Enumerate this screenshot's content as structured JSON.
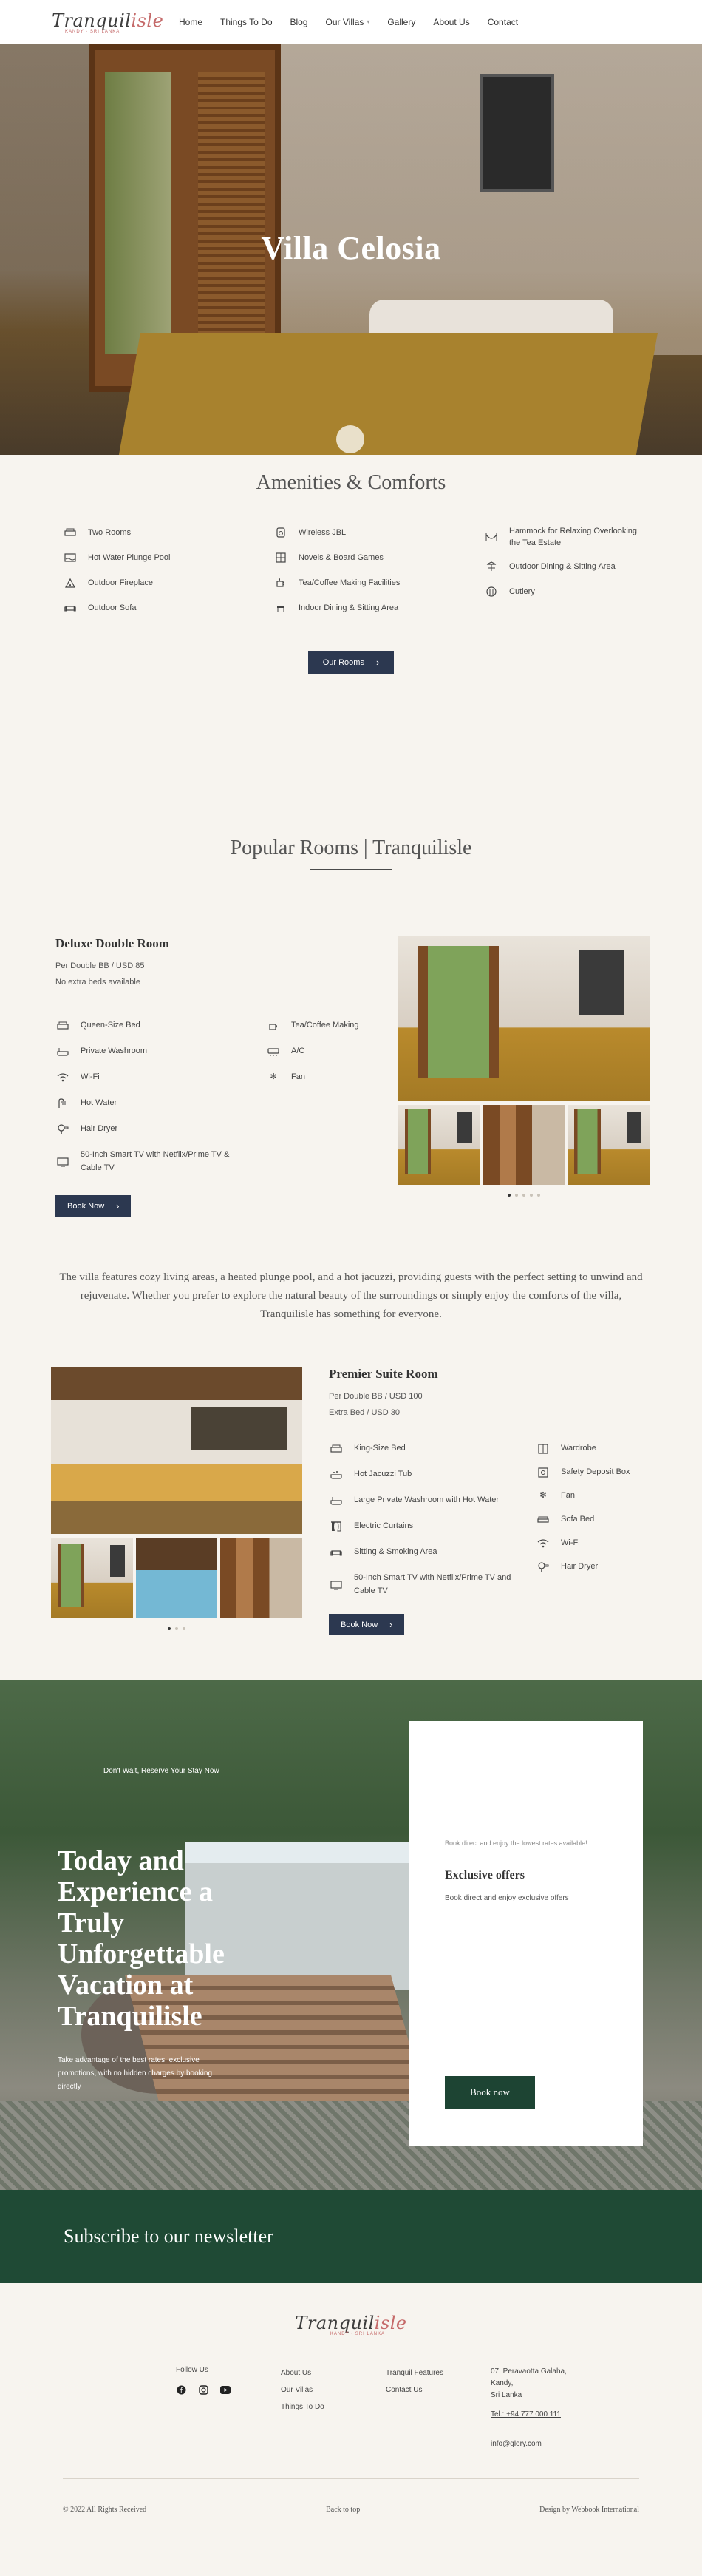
{
  "header": {
    "logo_main": "Tranquil",
    "logo_accent": "isle",
    "logo_sub": "KANDY · SRI LANKA",
    "nav": [
      {
        "label": "Home"
      },
      {
        "label": "Things To Do"
      },
      {
        "label": "Blog"
      },
      {
        "label": "Our Villas",
        "dropdown": true
      },
      {
        "label": "Gallery"
      },
      {
        "label": "About Us"
      },
      {
        "label": "Contact"
      }
    ]
  },
  "hero": {
    "title": "Villa Celosia"
  },
  "amenities": {
    "title": "Amenities & Comforts",
    "columns": [
      [
        {
          "icon": "bed-icon",
          "label": "Two Rooms"
        },
        {
          "icon": "pool-icon",
          "label": "Hot Water Plunge Pool"
        },
        {
          "icon": "fireplace-icon",
          "label": "Outdoor Fireplace"
        },
        {
          "icon": "sofa-icon",
          "label": "Outdoor Sofa"
        }
      ],
      [
        {
          "icon": "speaker-icon",
          "label": "Wireless JBL"
        },
        {
          "icon": "board-games-icon",
          "label": "Novels & Board Games"
        },
        {
          "icon": "kettle-icon",
          "label": "Tea/Coffee Making Facilities"
        },
        {
          "icon": "dining-icon",
          "label": "Indoor Dining & Sitting Area"
        }
      ],
      [
        {
          "icon": "hammock-icon",
          "label": "Hammock for Relaxing Overlooking the Tea Estate"
        },
        {
          "icon": "outdoor-dining-icon",
          "label": "Outdoor Dining & Sitting Area"
        },
        {
          "icon": "cutlery-icon",
          "label": "Cutlery"
        }
      ]
    ],
    "button": "Our Rooms"
  },
  "rooms": {
    "title": "Popular Rooms | Tranquilisle",
    "deluxe": {
      "name": "Deluxe Double Room",
      "price": "Per Double BB / USD 85",
      "extra": "No extra beds available",
      "features_left": [
        {
          "icon": "bed-icon",
          "label": "Queen-Size Bed"
        },
        {
          "icon": "bath-icon",
          "label": "Private Washroom"
        },
        {
          "icon": "wifi-icon",
          "label": "Wi-Fi"
        },
        {
          "icon": "shower-icon",
          "label": "Hot Water"
        },
        {
          "icon": "hair-dryer-icon",
          "label": "Hair Dryer"
        },
        {
          "icon": "tv-icon",
          "label": "50-Inch Smart TV with Netflix/Prime TV & Cable TV"
        }
      ],
      "features_right": [
        {
          "icon": "kettle-icon",
          "label": "Tea/Coffee Making"
        },
        {
          "icon": "ac-icon",
          "label": "A/C"
        },
        {
          "icon": "fan-icon",
          "label": "Fan"
        }
      ],
      "button": "Book Now"
    },
    "description": "The villa features cozy living areas, a heated plunge pool, and a hot jacuzzi, providing guests with the perfect setting to unwind and rejuvenate. Whether you prefer to explore the natural beauty of the surroundings or simply enjoy the comforts of the villa, Tranquilisle has something for everyone.",
    "premier": {
      "name": "Premier Suite Room",
      "price": "Per Double BB / USD 100",
      "extra": "Extra Bed / USD 30",
      "features_left": [
        {
          "icon": "bed-icon",
          "label": "King-Size Bed"
        },
        {
          "icon": "jacuzzi-icon",
          "label": "Hot Jacuzzi Tub"
        },
        {
          "icon": "bath-icon",
          "label": "Large Private Washroom with Hot Water"
        },
        {
          "icon": "curtain-icon",
          "label": "Electric Curtains"
        },
        {
          "icon": "sofa-icon",
          "label": "Sitting & Smoking Area"
        },
        {
          "icon": "tv-icon",
          "label": "50-Inch Smart TV with Netflix/Prime TV and Cable TV"
        }
      ],
      "features_right": [
        {
          "icon": "wardrobe-icon",
          "label": "Wardrobe"
        },
        {
          "icon": "safe-icon",
          "label": "Safety Deposit Box"
        },
        {
          "icon": "fan-icon",
          "label": "Fan"
        },
        {
          "icon": "sofa-bed-icon",
          "label": "Sofa Bed"
        },
        {
          "icon": "wifi-icon",
          "label": "Wi-Fi"
        },
        {
          "icon": "hair-dryer-icon",
          "label": "Hair Dryer"
        }
      ],
      "button": "Book Now"
    }
  },
  "cta": {
    "kicker": "Don't Wait, Reserve Your Stay Now",
    "title": "Today and Experience a Truly Unforgettable Vacation at Tranquilisle",
    "text": "Take advantage of the best rates, exclusive promotions, with no hidden charges by booking directly",
    "card_peek": "Book direct and enjoy the lowest rates available!",
    "card_title": "Exclusive offers",
    "card_sub": "Book direct and enjoy exclusive offers",
    "card_button": "Book now"
  },
  "newsletter": {
    "title": "Subscribe to our newsletter"
  },
  "footer": {
    "follow": "Follow Us",
    "links_a": [
      "About Us",
      "Our Villas",
      "Things To Do"
    ],
    "links_b": [
      "Tranquil Features",
      "Contact Us"
    ],
    "address": [
      "07, Peravaotta Galaha,",
      "Kandy,",
      "Sri Lanka"
    ],
    "phone": "Tel.: +94 777 000 111",
    "email": "info@glory.com",
    "copyright": "© 2022 All Rights Received",
    "back_to_top": "Back to top",
    "credit": "Design by Webbook International"
  },
  "colors": {
    "background": "#f7f4ef",
    "button_navy": "#2c3850",
    "brand_green": "#1f4a35",
    "logo_coral": "#c56a6a"
  }
}
